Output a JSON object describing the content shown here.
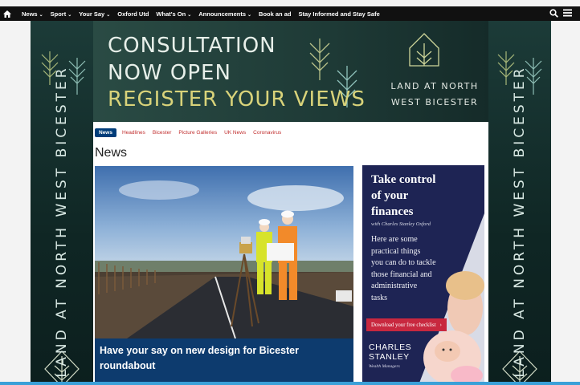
{
  "nav": {
    "items": [
      {
        "label": "News",
        "dropdown": true
      },
      {
        "label": "Sport",
        "dropdown": true
      },
      {
        "label": "Your Say",
        "dropdown": true
      },
      {
        "label": "Oxford Utd",
        "dropdown": false
      },
      {
        "label": "What's On",
        "dropdown": true
      },
      {
        "label": "Announcements",
        "dropdown": true
      },
      {
        "label": "Book an ad",
        "dropdown": false
      },
      {
        "label": "Stay Informed and Stay Safe",
        "dropdown": false
      }
    ]
  },
  "side_banner": {
    "text": "LAND AT NORTH WEST BICESTER"
  },
  "top_banner": {
    "line1": "CONSULTATION",
    "line2": "NOW OPEN",
    "line3": "REGISTER YOUR VIEWS",
    "brand_line1": "LAND AT NORTH",
    "brand_line2": "WEST BICESTER"
  },
  "section_tabs": {
    "active": "News",
    "items": [
      "Headlines",
      "Bicester",
      "Picture Galleries",
      "UK News",
      "Coronavirus"
    ]
  },
  "page_title": "News",
  "lead_story": {
    "headline_line1": "Have your say on new design for Bicester",
    "headline_line2": "roundabout"
  },
  "advert": {
    "heading_line1": "Take control",
    "heading_line2": "of your",
    "heading_line3": "finances",
    "with": "with Charles Stanley Oxford",
    "body_lines": [
      "Here are some",
      "practical things",
      "you can do to tackle",
      "those financial and",
      "administrative",
      "tasks"
    ],
    "cta": "Download your free checklist",
    "logo_line1": "CHARLES",
    "logo_line2": "STANLEY",
    "tagline": "Wealth Managers"
  },
  "colors": {
    "nav_bg": "#111111",
    "banner_green": "#1e3a36",
    "banner_yellow": "#d9d37a",
    "tab_active": "#003d7a",
    "tab_link": "#c12f2f",
    "caption_bg": "#0d3b6e",
    "ad_bg": "#1e2454",
    "cta_bg": "#c8283f"
  }
}
